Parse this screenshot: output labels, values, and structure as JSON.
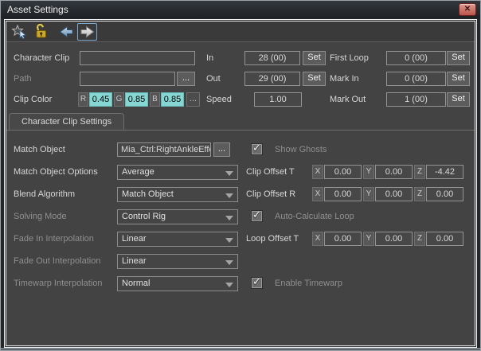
{
  "window": {
    "title": "Asset Settings"
  },
  "glyphs": {
    "close": "✕",
    "check": "✓"
  },
  "toolbar": {
    "icons": [
      "star-pick-icon",
      "unlock-icon",
      "back-arrow-icon",
      "forward-arrow-icon"
    ]
  },
  "clip_header": {
    "character_clip": {
      "label": "Character Clip",
      "value": ""
    },
    "path": {
      "label": "Path",
      "value": "",
      "browse_label": "..."
    },
    "clip_color": {
      "label": "Clip Color",
      "r_label": "R",
      "r_value": "0.45",
      "g_label": "G",
      "g_value": "0.85",
      "b_label": "B",
      "b_value": "0.85",
      "browse_label": "..."
    },
    "in": {
      "label": "In",
      "value": "28 (00)",
      "set_label": "Set"
    },
    "out": {
      "label": "Out",
      "value": "29 (00)",
      "set_label": "Set"
    },
    "speed": {
      "label": "Speed",
      "value": "1.00"
    },
    "first_loop": {
      "label": "First Loop",
      "value": "0 (00)",
      "set_label": "Set"
    },
    "mark_in": {
      "label": "Mark In",
      "value": "0 (00)",
      "set_label": "Set"
    },
    "mark_out": {
      "label": "Mark Out",
      "value": "1 (00)",
      "set_label": "Set"
    }
  },
  "tabs": {
    "active": "Character Clip Settings"
  },
  "settings": {
    "match_object": {
      "label": "Match Object",
      "value": "Mia_Ctrl:RightAnkleEffe...",
      "browse_label": "..."
    },
    "match_object_options": {
      "label": "Match Object Options",
      "value": "Average"
    },
    "blend_algorithm": {
      "label": "Blend Algorithm",
      "value": "Match Object"
    },
    "solving_mode": {
      "label": "Solving Mode",
      "value": "Control Rig"
    },
    "fade_in_interpolation": {
      "label": "Fade In Interpolation",
      "value": "Linear"
    },
    "fade_out_interpolation": {
      "label": "Fade Out Interpolation",
      "value": "Linear"
    },
    "timewarp_interpolation": {
      "label": "Timewarp Interpolation",
      "value": "Normal"
    },
    "show_ghosts": {
      "label": "Show Ghosts",
      "checked": true
    },
    "auto_calculate_loop": {
      "label": "Auto-Calculate Loop",
      "checked": true
    },
    "enable_timewarp": {
      "label": "Enable Timewarp",
      "checked": true
    },
    "clip_offset_t": {
      "label": "Clip Offset T",
      "x_label": "X",
      "x": "0.00",
      "y_label": "Y",
      "y": "0.00",
      "z_label": "Z",
      "z": "-4.42"
    },
    "clip_offset_r": {
      "label": "Clip Offset R",
      "x_label": "X",
      "x": "0.00",
      "y_label": "Y",
      "y": "0.00",
      "z_label": "Z",
      "z": "0.00"
    },
    "loop_offset_t": {
      "label": "Loop Offset T",
      "x_label": "X",
      "x": "0.00",
      "y_label": "Y",
      "y": "0.00",
      "z_label": "Z",
      "z": "0.00"
    }
  },
  "colors": {
    "clip_color_swatch": "#86d7d4",
    "close_button": "#b9534b",
    "selection_border": "#7fa8cc"
  }
}
